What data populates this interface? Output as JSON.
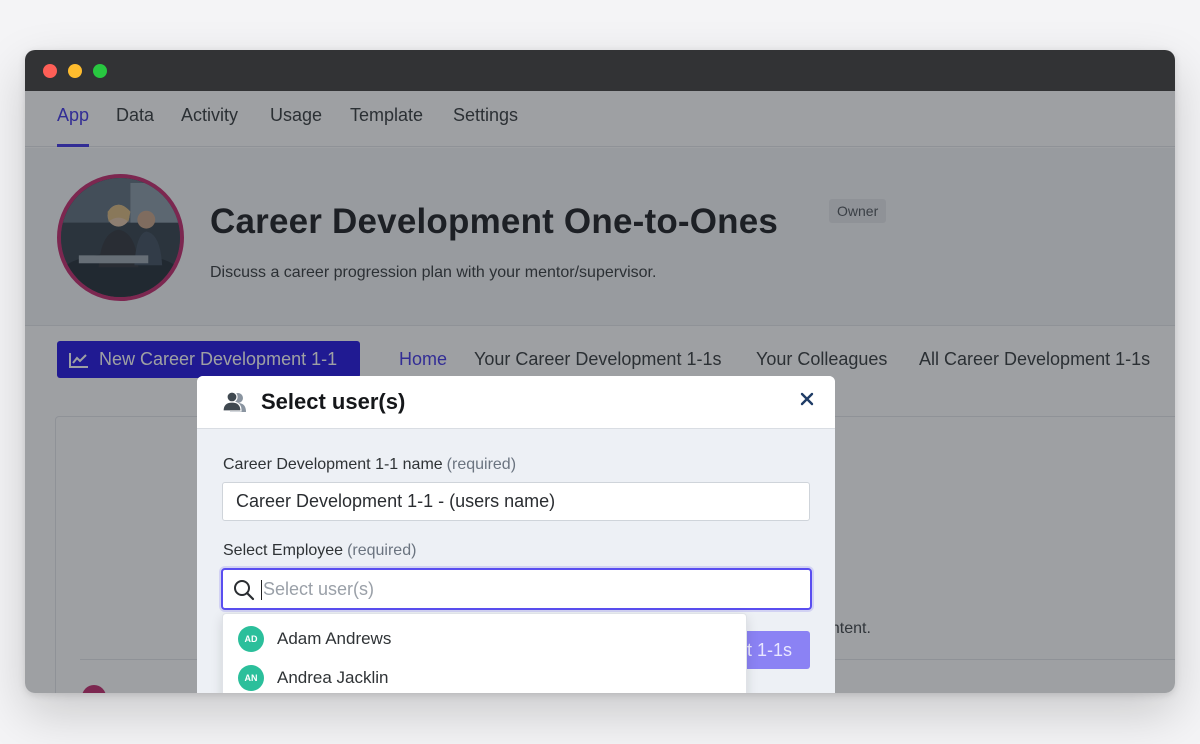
{
  "colors": {
    "accent": "#3b2ee6",
    "primary_button": "#1a0ce0",
    "avatar_ring": "#c22469",
    "user_avatar": "#2bbf9b"
  },
  "top_nav": {
    "tabs": [
      {
        "label": "App",
        "active": true
      },
      {
        "label": "Data"
      },
      {
        "label": "Activity"
      },
      {
        "label": "Usage"
      },
      {
        "label": "Template"
      },
      {
        "label": "Settings"
      }
    ]
  },
  "app": {
    "title": "Career Development One-to-Ones",
    "badge": "Owner",
    "description": "Discuss a career progression plan with your mentor/supervisor."
  },
  "sub_nav": {
    "new_button": "New Career Development 1-1",
    "links": [
      {
        "label": "Home",
        "active": true
      },
      {
        "label": "Your Career Development 1-1s"
      },
      {
        "label": "Your Colleagues"
      },
      {
        "label": "All Career Development 1-1s"
      }
    ]
  },
  "background": {
    "content_text": "ontent.",
    "button_text": "nt 1-1s"
  },
  "modal": {
    "title": "Select user(s)",
    "name_field": {
      "label": "Career Development 1-1 name",
      "required": "(required)",
      "value": "Career Development 1-1 - (users name)"
    },
    "employee_field": {
      "label": "Select Employee",
      "required": "(required)",
      "placeholder": "Select user(s)"
    },
    "options": [
      {
        "initials": "AD",
        "name": "Adam Andrews"
      },
      {
        "initials": "AN",
        "name": "Andrea Jacklin"
      }
    ]
  }
}
